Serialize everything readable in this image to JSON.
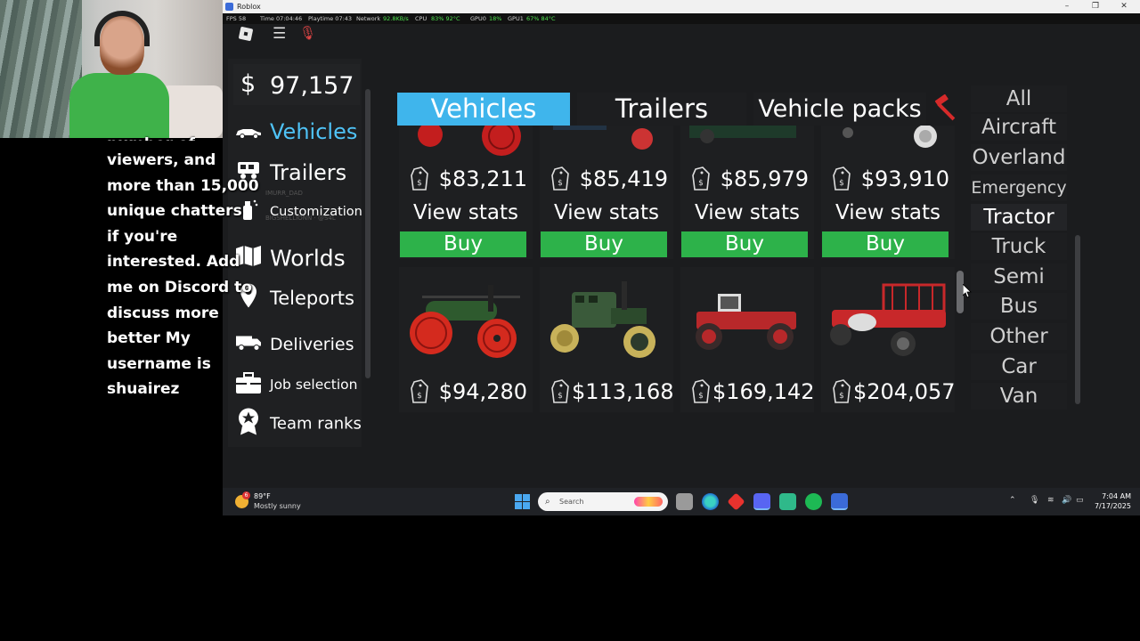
{
  "overlay": {
    "chat_lines": [
      "viewers, and",
      "more than 15,000",
      "unique chatters",
      "if you're",
      "interested. Add",
      "me on Discord to",
      "discuss more",
      "better My",
      "username is",
      "shuairez"
    ],
    "clipped_top_line": "number of"
  },
  "window": {
    "title": "Roblox",
    "controls": [
      "–",
      "❐",
      "✕"
    ],
    "stats": {
      "fps": "FPS 58",
      "time": "Time 07:04:46",
      "playtime": "Playtime 07:43",
      "network": "Network",
      "network_val": "92.8KB/s",
      "cpu": "CPU",
      "cpu_val": "83% 92°C",
      "gpu0": "GPU0",
      "gpu0_val": "18%",
      "gpu1": "GPU1",
      "gpu1_val": "67% 84°C"
    }
  },
  "sidebar": {
    "currency_symbol": "$",
    "balance": "97,157",
    "items": [
      {
        "label": "Vehicles",
        "icon": "car-icon",
        "active": true
      },
      {
        "label": "Trailers",
        "icon": "trailer-icon"
      },
      {
        "label": "Customization",
        "icon": "spray-icon"
      },
      {
        "label": "Worlds",
        "icon": "map-icon"
      },
      {
        "label": "Teleports",
        "icon": "pin-icon"
      },
      {
        "label": "Deliveries",
        "icon": "truck-icon"
      },
      {
        "label": "Job selection",
        "icon": "briefcase-icon"
      },
      {
        "label": "Team ranks",
        "icon": "star-badge-icon"
      }
    ],
    "ghost_text": [
      "IMURR_DAD",
      "BIGSHELLIONN · @S4L"
    ]
  },
  "tabs": [
    {
      "label": "Vehicles",
      "active": true
    },
    {
      "label": "Trailers"
    },
    {
      "label": "Vehicle packs"
    }
  ],
  "grid": {
    "stats_label": "View stats",
    "buy_label": "Buy",
    "row1": [
      {
        "price": "$83,211"
      },
      {
        "price": "$85,419"
      },
      {
        "price": "$85,979"
      },
      {
        "price": "$93,910"
      }
    ],
    "row2": [
      {
        "price": "$94,280",
        "vehicle": "steam-tractor"
      },
      {
        "price": "$113,168",
        "vehicle": "steam-roller"
      },
      {
        "price": "$169,142",
        "vehicle": "red-4wd-tractor"
      },
      {
        "price": "$204,057",
        "vehicle": "red-cage-tractor"
      }
    ]
  },
  "categories": [
    {
      "label": "All"
    },
    {
      "label": "Aircraft"
    },
    {
      "label": "Overland"
    },
    {
      "label": "Emergency"
    },
    {
      "label": "Tractor",
      "active": true
    },
    {
      "label": "Truck"
    },
    {
      "label": "Semi"
    },
    {
      "label": "Bus"
    },
    {
      "label": "Other"
    },
    {
      "label": "Car"
    },
    {
      "label": "Van"
    }
  ],
  "taskbar": {
    "weather_badge": "6",
    "weather_temp": "89°F",
    "weather_desc": "Mostly sunny",
    "search_placeholder": "Search",
    "time": "7:04 AM",
    "date": "7/17/2025"
  },
  "colors": {
    "accent": "#3fb5ec",
    "buy": "#2db24a",
    "active_sidebar": "#4fc3f7",
    "panel": "#1b1c1e"
  }
}
